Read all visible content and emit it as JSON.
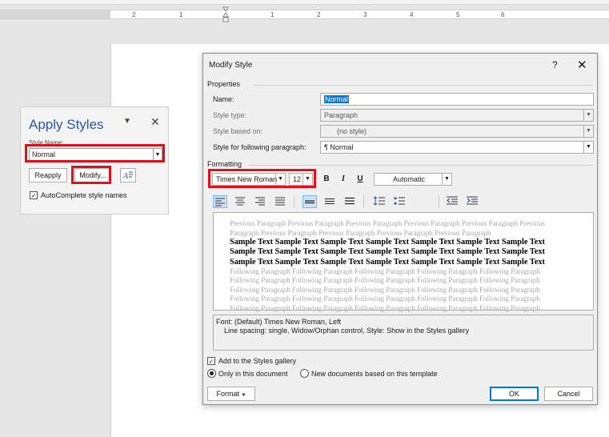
{
  "ruler": {
    "numbers": [
      "2",
      "1",
      "1",
      "2",
      "3",
      "4",
      "5",
      "6"
    ]
  },
  "apply_styles": {
    "title": "Apply Styles",
    "style_name_label": "Style Name:",
    "style_name_value": "Normal",
    "reapply_label": "Reapply",
    "modify_label": "Modify...",
    "autocomplete_label": "AutoComplete style names",
    "autocomplete_checked": true
  },
  "dialog": {
    "title": "Modify Style",
    "help": "?",
    "close": "✕",
    "properties_label": "Properties",
    "name_label": "Name:",
    "name_value": "Normal",
    "style_type_label": "Style type:",
    "style_type_value": "Paragraph",
    "style_based_label": "Style based on:",
    "style_based_value": "(no style)",
    "following_label": "Style for following paragraph:",
    "following_value": "¶  Normal",
    "formatting_label": "Formatting",
    "font_value": "Times New Roman",
    "size_value": "12",
    "bold": "B",
    "italic": "I",
    "underline": "U",
    "color_value": "Automatic",
    "preview": {
      "previous": [
        "Previous Paragraph Previous Paragraph Previous Paragraph Previous Paragraph Previous Paragraph Previous",
        "Paragraph Previous Paragraph Previous Paragraph Previous Paragraph Previous Paragraph"
      ],
      "sample": [
        "Sample Text Sample Text Sample Text Sample Text Sample Text Sample Text Sample Text",
        "Sample Text Sample Text Sample Text Sample Text Sample Text Sample Text Sample Text",
        "Sample Text Sample Text Sample Text Sample Text Sample Text Sample Text Sample Text"
      ],
      "following": [
        "Following Paragraph Following Paragraph Following Paragraph Following Paragraph Following Paragraph",
        "Following Paragraph Following Paragraph Following Paragraph Following Paragraph Following Paragraph",
        "Following Paragraph Following Paragraph Following Paragraph Following Paragraph Following Paragraph",
        "Following Paragraph Following Paragraph Following Paragraph Following Paragraph Following Paragraph",
        "Following Paragraph Following Paragraph Following Paragraph Following Paragraph Following Paragraph"
      ]
    },
    "description_line1": "Font: (Default) Times New Roman, Left",
    "description_line2": "Line spacing:  single, Widow/Orphan control, Style: Show in the Styles gallery",
    "add_gallery_label": "Add to the Styles gallery",
    "add_gallery_checked": true,
    "only_doc_label": "Only in this document",
    "new_docs_label": "New documents based on this template",
    "format_label": "Format",
    "ok_label": "OK",
    "cancel_label": "Cancel"
  },
  "colors": {
    "highlight_red": "#e0101a",
    "title_blue": "#2b579a",
    "ok_border": "#0078d7"
  }
}
